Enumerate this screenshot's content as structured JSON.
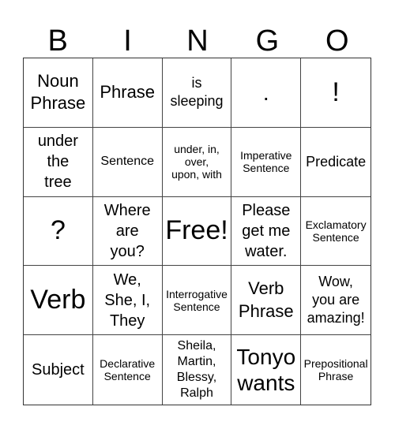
{
  "header": [
    "B",
    "I",
    "N",
    "G",
    "O"
  ],
  "cells": [
    {
      "text": "Noun\nPhrase",
      "size": "s-xl"
    },
    {
      "text": "Phrase",
      "size": "s-xl"
    },
    {
      "text": "is\nsleeping",
      "size": "s-md"
    },
    {
      "text": ".",
      "size": "s-xxl"
    },
    {
      "text": "!",
      "size": "s-huge"
    },
    {
      "text": "under\nthe\ntree",
      "size": "s-lg"
    },
    {
      "text": "Sentence",
      "size": "s-sm"
    },
    {
      "text": "under, in,\nover,\nupon, with",
      "size": "s-xs"
    },
    {
      "text": "Imperative\nSentence",
      "size": "s-xs"
    },
    {
      "text": "Predicate",
      "size": "s-md"
    },
    {
      "text": "?",
      "size": "s-huge"
    },
    {
      "text": "Where\nare\nyou?",
      "size": "s-lg"
    },
    {
      "text": "Free!",
      "size": "s-huge"
    },
    {
      "text": "Please\nget me\nwater.",
      "size": "s-lg"
    },
    {
      "text": "Exclamatory\nSentence",
      "size": "s-xs"
    },
    {
      "text": "Verb",
      "size": "s-huge"
    },
    {
      "text": "We,\nShe, I,\nThey",
      "size": "s-lg"
    },
    {
      "text": "Interrogative\nSentence",
      "size": "s-xs"
    },
    {
      "text": "Verb\nPhrase",
      "size": "s-xl"
    },
    {
      "text": "Wow,\nyou are\namazing!",
      "size": "s-md"
    },
    {
      "text": "Subject",
      "size": "s-lg"
    },
    {
      "text": "Declarative\nSentence",
      "size": "s-xs"
    },
    {
      "text": "Sheila,\nMartin,\nBlessy,\nRalph",
      "size": "s-sm"
    },
    {
      "text": "Tonyo\nwants",
      "size": "s-xxl"
    },
    {
      "text": "Prepositional\nPhrase",
      "size": "s-xs"
    }
  ]
}
